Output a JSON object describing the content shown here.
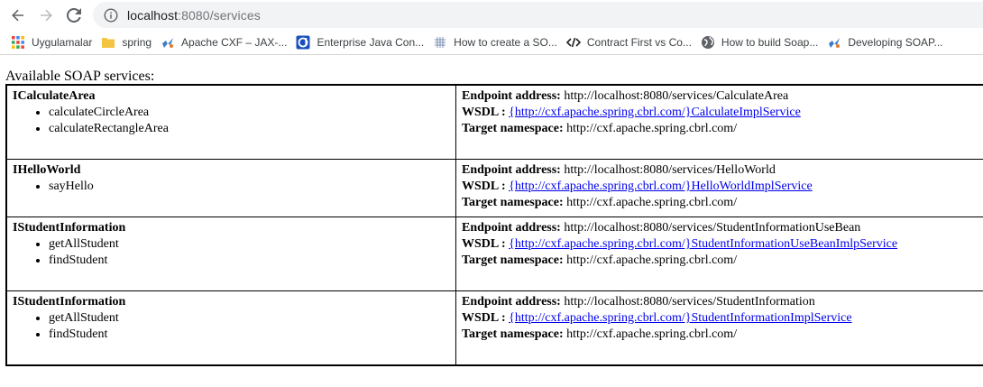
{
  "browser": {
    "url_host": "localhost",
    "url_path": ":8080/services",
    "bookmarks": [
      {
        "label": "Uygulamalar",
        "icon": "apps-grid-icon"
      },
      {
        "label": "spring",
        "icon": "folder-icon"
      },
      {
        "label": "Apache CXF – JAX-...",
        "icon": "cxf-icon"
      },
      {
        "label": "Enterprise Java Con...",
        "icon": "site-icon"
      },
      {
        "label": "How to create a SO...",
        "icon": "site-icon"
      },
      {
        "label": "Contract First vs Co...",
        "icon": "code-icon"
      },
      {
        "label": "How to build Soap...",
        "icon": "globe-icon"
      },
      {
        "label": "Developing SOAP...",
        "icon": "cxf-icon"
      }
    ]
  },
  "page": {
    "heading": "Available SOAP services:",
    "labels": {
      "endpoint": "Endpoint address:",
      "wsdl": "WSDL :",
      "namespace": "Target namespace:"
    },
    "services": [
      {
        "interface": "ICalculateArea",
        "operations": [
          "calculateCircleArea",
          "calculateRectangleArea"
        ],
        "endpoint": "http://localhost:8080/services/CalculateArea",
        "wsdl": "{http://cxf.apache.spring.cbrl.com/}CalculateImplService",
        "namespace": "http://cxf.apache.spring.cbrl.com/"
      },
      {
        "interface": "IHelloWorld",
        "operations": [
          "sayHello"
        ],
        "endpoint": "http://localhost:8080/services/HelloWorld",
        "wsdl": "{http://cxf.apache.spring.cbrl.com/}HelloWorldImplService",
        "namespace": "http://cxf.apache.spring.cbrl.com/"
      },
      {
        "interface": "IStudentInformation",
        "operations": [
          "getAllStudent",
          "findStudent"
        ],
        "endpoint": "http://localhost:8080/services/StudentInformationUseBean",
        "wsdl": "{http://cxf.apache.spring.cbrl.com/}StudentInformationUseBeanImlpService",
        "namespace": "http://cxf.apache.spring.cbrl.com/"
      },
      {
        "interface": "IStudentInformation",
        "operations": [
          "getAllStudent",
          "findStudent"
        ],
        "endpoint": "http://localhost:8080/services/StudentInformation",
        "wsdl": "{http://cxf.apache.spring.cbrl.com/}StudentInformationImplService",
        "namespace": "http://cxf.apache.spring.cbrl.com/"
      }
    ]
  }
}
